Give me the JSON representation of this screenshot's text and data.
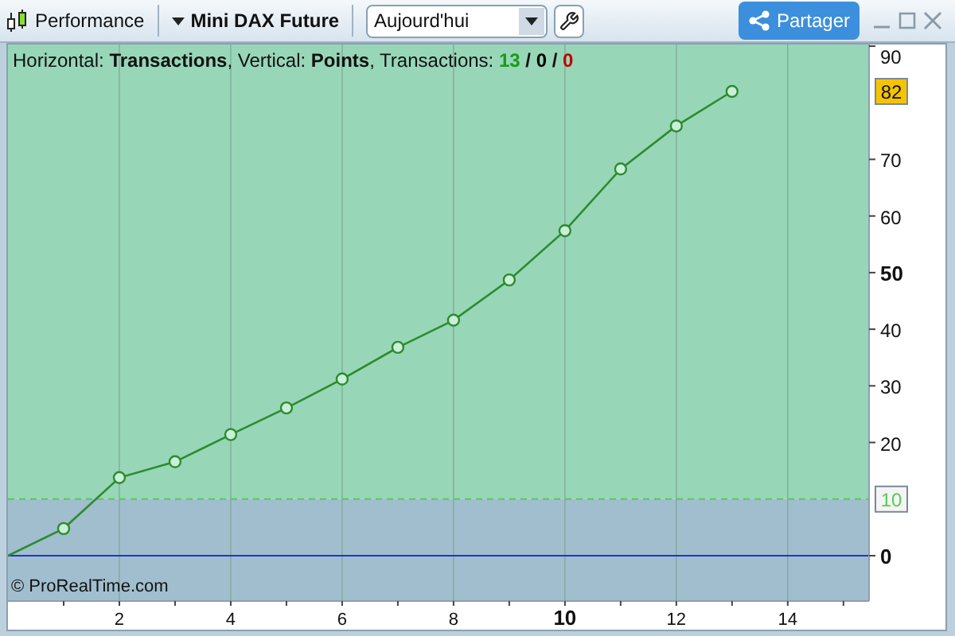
{
  "toolbar": {
    "title": "Performance",
    "instrument": "Mini DAX Future",
    "period": "Aujourd'hui",
    "share": "Partager"
  },
  "legend": [
    {
      "kind": "plain",
      "text": "Horizontal: "
    },
    {
      "kind": "bold",
      "text": "Transactions"
    },
    {
      "kind": "plain",
      "text": ", Vertical: "
    },
    {
      "kind": "series"
    },
    {
      "kind": "plain",
      "text": ", Transactions: "
    },
    {
      "kind": "win",
      "text": "13"
    },
    {
      "kind": "bold",
      "text": " / "
    },
    {
      "kind": "even",
      "text": "0"
    },
    {
      "kind": "bold",
      "text": " / "
    },
    {
      "kind": "loss",
      "text": "0"
    }
  ],
  "copyright": "© ProRealTime.com",
  "chart_data": {
    "type": "line",
    "x": [
      0,
      1,
      2,
      3,
      4,
      5,
      6,
      7,
      8,
      9,
      10,
      11,
      12,
      13
    ],
    "series": [
      {
        "name": "Points",
        "color": "#2e8b2e",
        "marker": "o",
        "values": [
          0,
          4.8,
          13.8,
          16.6,
          21.4,
          26.1,
          31.2,
          36.8,
          41.6,
          48.7,
          57.4,
          68.3,
          75.9,
          82
        ]
      }
    ],
    "xlim": [
      0,
      15.46
    ],
    "ylim": [
      -8,
      90
    ],
    "grid": true,
    "xticks": [
      2,
      4,
      6,
      8,
      {
        "value": 10,
        "label": "10"
      },
      12,
      14
    ],
    "yticks": [
      0,
      20,
      30,
      40,
      50,
      60,
      70,
      90
    ],
    "ref_lines": [
      {
        "axis": "y",
        "value": 10,
        "label": "10",
        "color": "#55cc55"
      },
      {
        "axis": "y",
        "value": 0,
        "color": "#2233cc"
      }
    ],
    "bands": [
      {
        "axis": "y",
        "from": 10,
        "to": 90,
        "color": "#98d6b8"
      },
      {
        "axis": "y",
        "from": -8,
        "to": 10,
        "color": "#a0bece"
      }
    ],
    "annotations": [
      "82"
    ]
  }
}
